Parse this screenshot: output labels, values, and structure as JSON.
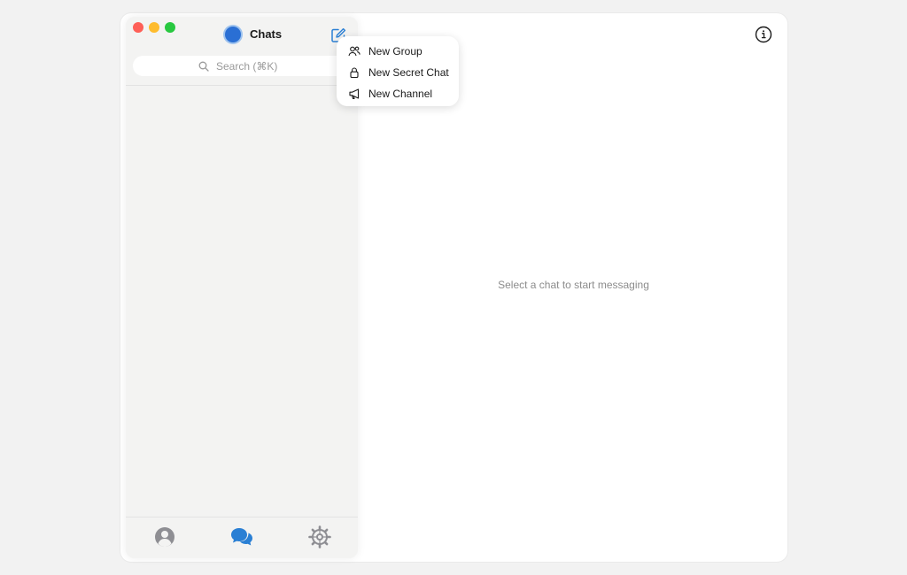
{
  "sidebar": {
    "title": "Chats",
    "search": {
      "placeholder": "Search (⌘K)",
      "value": ""
    },
    "compose_icon": "compose-icon",
    "tabs": [
      {
        "name": "contacts",
        "icon": "person-circle-icon",
        "active": false
      },
      {
        "name": "chats",
        "icon": "chat-bubbles-icon",
        "active": true
      },
      {
        "name": "settings",
        "icon": "gear-icon",
        "active": false
      }
    ]
  },
  "compose_menu": {
    "items": [
      {
        "label": "New Group",
        "icon": "group-icon"
      },
      {
        "label": "New Secret Chat",
        "icon": "lock-icon"
      },
      {
        "label": "New Channel",
        "icon": "megaphone-icon"
      }
    ]
  },
  "main": {
    "empty_text": "Select a chat to start messaging",
    "info_icon": "info-icon"
  },
  "colors": {
    "accent": "#2a7fd4",
    "traffic_red": "#fe5f57",
    "traffic_yellow": "#febc2e",
    "traffic_green": "#28c840"
  }
}
